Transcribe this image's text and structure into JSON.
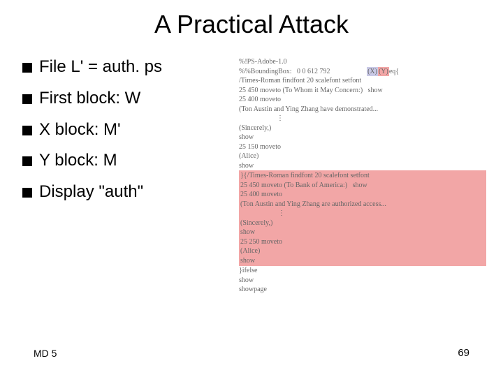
{
  "title": "A Practical Attack",
  "bullets": [
    "File L' = auth. ps",
    "First block: W",
    "X block: M'",
    "Y block: M",
    "Display \"auth\""
  ],
  "code": {
    "l1a": "%!PS-Adobe-1.0",
    "l1b_pre": "%%BoundingBox:   0 0 612 792",
    "l1b_x": "(X)",
    "l1b_y": "(Y)",
    "l1b_post": "eq{",
    "l2": "/Times-Roman findfont 20 scalefont setfont",
    "l3": "25 450 moveto (To Whom it May Concern:)   show",
    "l4": "25 400 moveto",
    "l5": "(Ton Austin and Ying Zhang have demonstrated...",
    "dots1": "⋮",
    "l6": "(Sincerely,)",
    "l7": "show",
    "l8": "25 150 moveto",
    "l9": "(Alice)",
    "l10": "show",
    "y_open": "}{",
    "y1": "/Times-Roman findfont 20 scalefont setfont",
    "y2": "25 450 moveto (To Bank of America:)   show",
    "y3": "25 400 moveto",
    "y4": "(Ton Austin and Ying Zhang are authorized access...",
    "dots2": "⋮",
    "y5": "(Sincerely,)",
    "y6": "show",
    "y7": "25 250 moveto",
    "y8": "(Alice)",
    "y9": "show",
    "tail1": "}ifelse",
    "tail2": "show",
    "tail3": "showpage"
  },
  "footer": {
    "left": "MD 5",
    "right": "69"
  }
}
